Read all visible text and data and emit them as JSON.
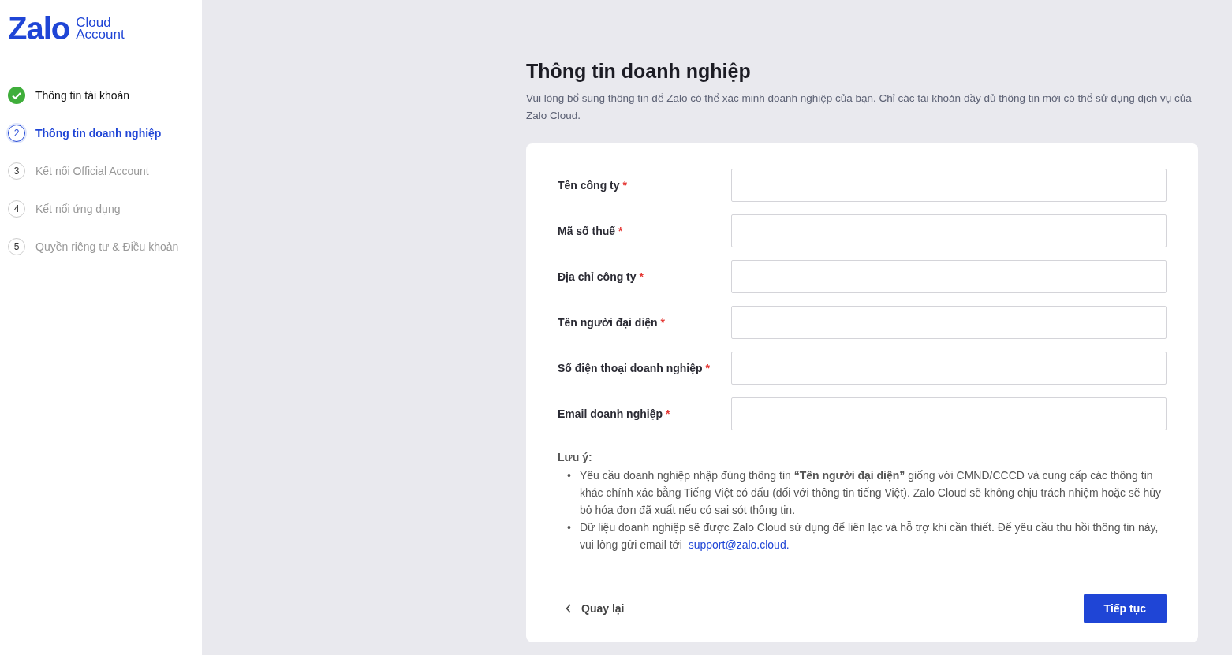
{
  "logo": {
    "wordmark": "Zalo",
    "product_line_1": "Cloud",
    "product_line_2": "Account"
  },
  "steps": [
    {
      "label": "Thông tin tài khoản",
      "done": true,
      "selected": false
    },
    {
      "number": "2",
      "label": "Thông tin doanh nghiệp",
      "done": false,
      "selected": true
    },
    {
      "number": "3",
      "label": "Kết nối Official Account",
      "done": false,
      "selected": false
    },
    {
      "number": "4",
      "label": "Kết nối ứng dụng",
      "done": false,
      "selected": false
    },
    {
      "number": "5",
      "label": "Quyền riêng tư & Điều khoản",
      "done": false,
      "selected": false
    }
  ],
  "page": {
    "title": "Thông tin doanh nghiệp",
    "description": "Vui lòng bổ sung thông tin để Zalo có thể xác minh doanh nghiệp của bạn. Chỉ các tài khoản đầy đủ thông tin mới có thể sử dụng dịch vụ của Zalo Cloud."
  },
  "form": {
    "fields": [
      {
        "label": "Tên công ty",
        "required": true
      },
      {
        "label": "Mã số thuế",
        "required": true
      },
      {
        "label": "Địa chỉ công ty",
        "required": true
      },
      {
        "label": "Tên người đại diện",
        "required": true
      },
      {
        "label": "Số điện thoại doanh nghiệp",
        "required": true
      },
      {
        "label": "Email doanh nghiệp",
        "required": true
      }
    ],
    "required_mark": "*",
    "note": {
      "title": "Lưu ý:",
      "bullet": "•",
      "items": [
        {
          "text": "Yêu cầu doanh nghiệp nhập đúng thông tin **“Tên người đại diện”** giống với CMND/CCCD và cung cấp các thông tin khác chính xác bằng Tiếng Việt có dấu (đối với thông tin tiếng Việt). Zalo Cloud sẽ không chịu trách nhiệm hoặc sẽ hủy bỏ hóa đơn đã xuất nếu có sai sót thông tin."
        },
        {
          "text": "Dữ liệu doanh nghiệp sẽ được Zalo Cloud sử dụng để liên lạc và hỗ trợ khi cần thiết. Để yêu cầu thu hồi thông tin này, vui lòng gửi email tới ",
          "link": "support@zalo.cloud."
        }
      ]
    },
    "back_button": "Quay lại",
    "next_button": "Tiếp tục"
  }
}
